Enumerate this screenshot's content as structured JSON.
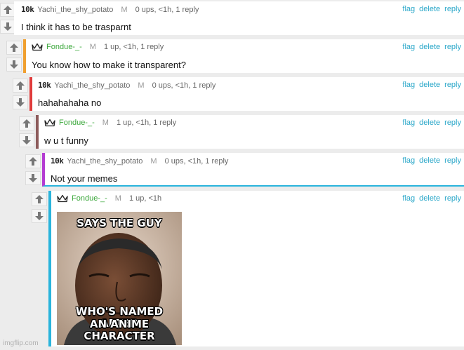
{
  "colors": {
    "accent_link": "#2aa7c9",
    "thread_level_1": "#f0a030",
    "thread_level_2": "#e03c3c",
    "thread_level_3": "#8c5a5a",
    "thread_level_4": "#b43cd2",
    "thread_level_5": "#2ab4dc"
  },
  "actions": {
    "flag": "flag",
    "delete": "delete",
    "reply": "reply"
  },
  "comments": [
    {
      "badge": "10k",
      "icon": "none",
      "username": "Yachi_the_shy_potato",
      "mod": "M",
      "stats": "0 ups, <1h, 1 reply",
      "text": "I think it has to be trasparnt"
    },
    {
      "badge": "",
      "icon": "crown-icon",
      "username": "Fondue-_-",
      "mod": "M",
      "stats": "1 up, <1h, 1 reply",
      "text": "You know how to make it transparent?"
    },
    {
      "badge": "10k",
      "icon": "none",
      "username": "Yachi_the_shy_potato",
      "mod": "M",
      "stats": "0 ups, <1h, 1 reply",
      "text": "hahahahaha no"
    },
    {
      "badge": "",
      "icon": "crown-icon",
      "username": "Fondue-_-",
      "mod": "M",
      "stats": "1 up, <1h, 1 reply",
      "text": "w u t funny"
    },
    {
      "badge": "10k",
      "icon": "none",
      "username": "Yachi_the_shy_potato",
      "mod": "M",
      "stats": "0 ups, <1h, 1 reply",
      "text": "Not your memes"
    },
    {
      "badge": "",
      "icon": "crown-icon",
      "username": "Fondue-_-",
      "mod": "M",
      "stats": "1 up, <1h",
      "text": ""
    }
  ],
  "meme": {
    "top_caption": "SAYS THE GUY",
    "bottom_caption_line1": "WHO'S NAMED AFTER",
    "bottom_caption_line2": "AN ANIME CHARACTER"
  },
  "watermark": "imgflip.com"
}
